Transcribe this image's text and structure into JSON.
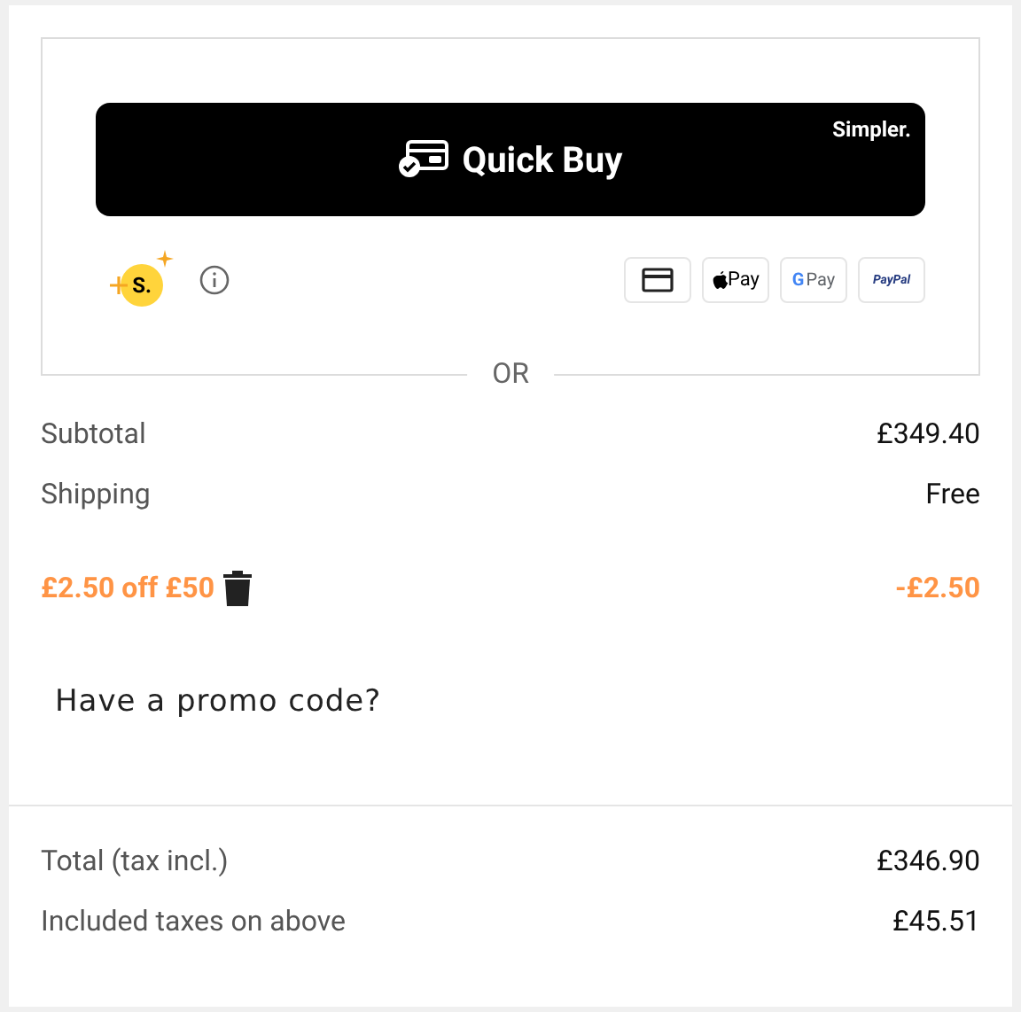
{
  "quick_buy": {
    "label": "Quick Buy",
    "tagline": "Simpler.",
    "coin_label": "S.",
    "payment_methods": [
      {
        "kind": "card"
      },
      {
        "kind": "apple",
        "label": "Pay"
      },
      {
        "kind": "google",
        "mark": "G",
        "label": "Pay"
      },
      {
        "kind": "paypal",
        "label": "PayPal"
      }
    ]
  },
  "separator": "OR",
  "summary": [
    {
      "label": "Subtotal",
      "value": "£349.40"
    },
    {
      "label": "Shipping",
      "value": "Free"
    }
  ],
  "discount": {
    "label": "£2.50 off £50",
    "value": "-£2.50"
  },
  "promo_link": "Have a promo code?",
  "totals": [
    {
      "label": "Total (tax incl.)",
      "value": "£346.90"
    },
    {
      "label": "Included taxes on above",
      "value": "£45.51"
    }
  ]
}
